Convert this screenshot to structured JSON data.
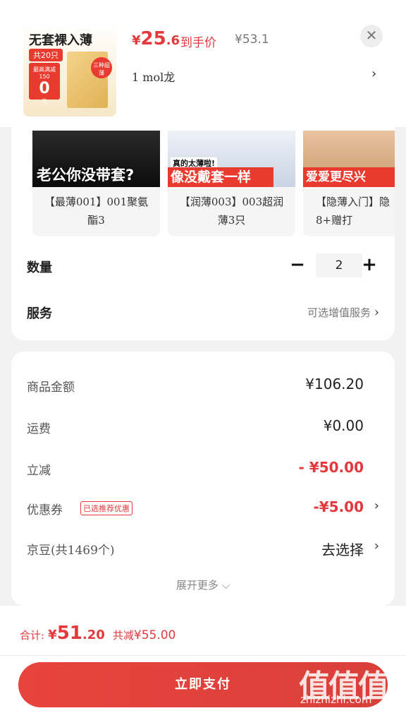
{
  "product": {
    "thumb": {
      "headline": "无套裸入薄",
      "badge": "共20只",
      "promo_line": "最高满减150",
      "promo_value": "0",
      "promo_unit": "元",
      "corner_tag": "三种超薄"
    },
    "price_currency": "¥",
    "price_int": "25",
    "price_dec": ".6",
    "price_label": "到手价",
    "original_price": "¥53.1",
    "spec": "1  mol龙",
    "close_glyph": "✕",
    "arrow_glyph": "›"
  },
  "variants": [
    {
      "caption": "老公你没带套?",
      "name": "【最薄001】001聚氨酯3",
      "color": "#111111"
    },
    {
      "caption": "像没戴套一样",
      "name": "【润薄003】003超润薄3只",
      "color": "#cfd8e6"
    },
    {
      "caption": "爱爱更尽兴",
      "name": "【隐薄入门】隐8+赠打",
      "color": "#d9b28a"
    }
  ],
  "variant_badge": "真的太薄啦!",
  "quantity": {
    "label": "数量",
    "minus": "−",
    "value": "2",
    "plus": "+"
  },
  "service": {
    "label": "服务",
    "value": "可选增值服务"
  },
  "summary": {
    "rows": [
      {
        "key": "商品金额",
        "value": "¥106.20"
      },
      {
        "key": "运费",
        "value": "¥0.00"
      },
      {
        "key": "立减",
        "value": "- ¥50.00"
      },
      {
        "key": "优惠券",
        "tag": "已选推荐优惠",
        "value": "-¥5.00"
      },
      {
        "key": "京豆(共1469个)",
        "value": "去选择"
      }
    ],
    "expand": "展开更多 ⌵"
  },
  "footer": {
    "total_label": "合计:",
    "total_currency": "¥",
    "total_int": "51",
    "total_dec": ".20",
    "discount_label": "共减",
    "discount_value": "¥55.00",
    "pay_button": "立即支付"
  },
  "watermark": {
    "glyphs": "值值值",
    "site": "zhizhizhi.com"
  },
  "colors": {
    "accent": "#e4393c",
    "background": "#f2f2f2"
  }
}
